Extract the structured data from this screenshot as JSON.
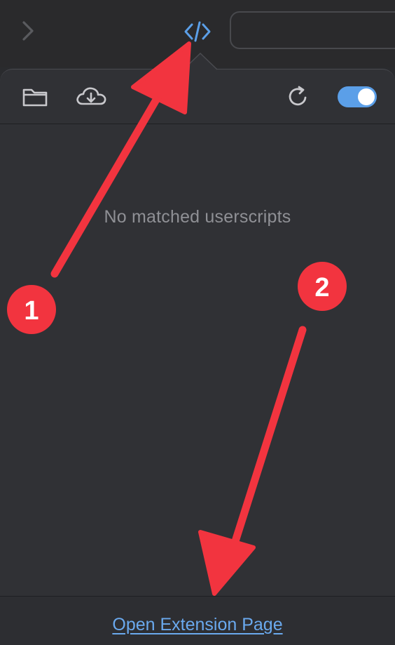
{
  "browser_toolbar": {
    "forward_icon": "chevron-right-icon",
    "extension_icon": "code-brackets-icon",
    "accent_color": "#5b9fe8"
  },
  "popover": {
    "header": {
      "open_folder_icon": "folder-icon",
      "download_icon": "cloud-download-icon",
      "refresh_icon": "refresh-icon",
      "enabled": true
    },
    "empty_message": "No matched userscripts",
    "footer_link": "Open Extension Page"
  },
  "annotations": {
    "arrow_color": "#f2343f",
    "markers": [
      {
        "label": "1"
      },
      {
        "label": "2"
      }
    ]
  }
}
